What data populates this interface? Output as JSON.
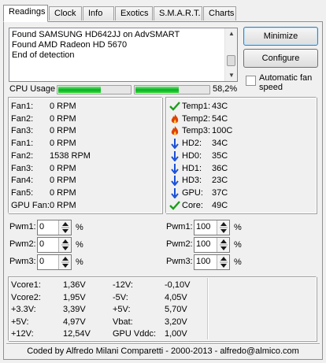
{
  "tabs": [
    "Readings",
    "Clock",
    "Info",
    "Exotics",
    "S.M.A.R.T.",
    "Charts"
  ],
  "log": [
    "Found SAMSUNG HD642JJ on AdvSMART",
    "Found AMD Radeon HD 5670",
    "End of detection"
  ],
  "buttons": {
    "minimize": "Minimize",
    "configure": "Configure"
  },
  "auto_fan": {
    "line1": "Automatic fan",
    "line2": "speed",
    "checked": false
  },
  "cpu_usage": {
    "label": "CPU Usage",
    "value": "58,2%",
    "bar1_fill": 0.58,
    "bar2_fill": 0.58
  },
  "fans": [
    {
      "name": "Fan1:",
      "value": "0 RPM"
    },
    {
      "name": "Fan2:",
      "value": "0 RPM"
    },
    {
      "name": "Fan3:",
      "value": "0 RPM"
    },
    {
      "name": "Fan1:",
      "value": "0 RPM"
    },
    {
      "name": "Fan2:",
      "value": "1538 RPM"
    },
    {
      "name": "Fan3:",
      "value": "0 RPM"
    },
    {
      "name": "Fan4:",
      "value": "0 RPM"
    },
    {
      "name": "Fan5:",
      "value": "0 RPM"
    },
    {
      "name": "GPU Fan:",
      "value": "0 RPM"
    }
  ],
  "temps": [
    {
      "icon": "check-icon",
      "name": "Temp1:",
      "value": "43C"
    },
    {
      "icon": "flame-icon",
      "name": "Temp2:",
      "value": "54C"
    },
    {
      "icon": "flame-icon",
      "name": "Temp3:",
      "value": "100C"
    },
    {
      "icon": "down-arrow-icon",
      "name": "HD2:",
      "value": "34C"
    },
    {
      "icon": "down-arrow-icon",
      "name": "HD0:",
      "value": "35C"
    },
    {
      "icon": "down-arrow-icon",
      "name": "HD1:",
      "value": "36C"
    },
    {
      "icon": "down-arrow-icon",
      "name": "HD3:",
      "value": "23C"
    },
    {
      "icon": "down-arrow-icon",
      "name": "GPU:",
      "value": "37C"
    },
    {
      "icon": "check-icon",
      "name": "Core:",
      "value": "49C"
    }
  ],
  "pwm_left": [
    {
      "label": "Pwm1:",
      "value": "0",
      "unit": "%"
    },
    {
      "label": "Pwm2:",
      "value": "0",
      "unit": "%"
    },
    {
      "label": "Pwm3:",
      "value": "0",
      "unit": "%"
    }
  ],
  "pwm_right": [
    {
      "label": "Pwm1:",
      "value": "100",
      "unit": "%"
    },
    {
      "label": "Pwm2:",
      "value": "100",
      "unit": "%"
    },
    {
      "label": "Pwm3:",
      "value": "100",
      "unit": "%"
    }
  ],
  "voltages_left": [
    {
      "name": "Vcore1:",
      "value": "1,36V"
    },
    {
      "name": "Vcore2:",
      "value": "1,95V"
    },
    {
      "name": "+3.3V:",
      "value": "3,39V"
    },
    {
      "name": "+5V:",
      "value": "4,97V"
    },
    {
      "name": "+12V:",
      "value": "12,54V"
    }
  ],
  "voltages_right": [
    {
      "name": "-12V:",
      "value": "-0,10V"
    },
    {
      "name": "-5V:",
      "value": "4,05V"
    },
    {
      "name": "+5V:",
      "value": "5,70V"
    },
    {
      "name": "Vbat:",
      "value": "3,20V"
    },
    {
      "name": "GPU Vddc:",
      "value": "1,00V"
    }
  ],
  "footer": "Coded by Alfredo Milani Comparetti - 2000-2013 - alfredo@almico.com",
  "colors": {
    "check": "#1a9e1a",
    "flame": "#e04000",
    "arrow": "#1a4fd6",
    "bar": "#06b025"
  }
}
